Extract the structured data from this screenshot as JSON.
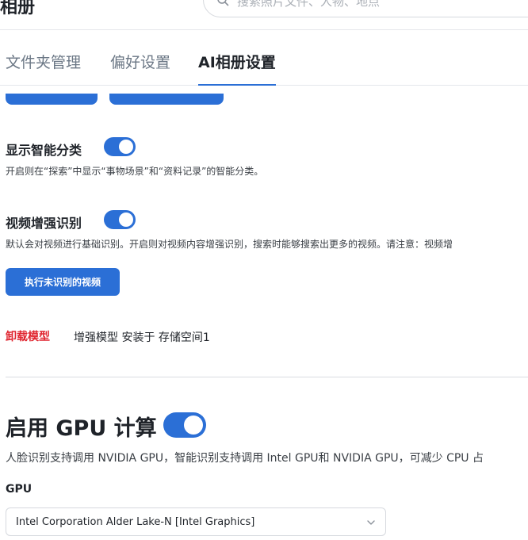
{
  "header": {
    "app_title": "相册",
    "search_placeholder": "搜索照片文件、人物、地点"
  },
  "tabs": [
    {
      "label": "文件夹管理",
      "active": false
    },
    {
      "label": "偏好设置",
      "active": false
    },
    {
      "label": "AI相册设置",
      "active": true
    }
  ],
  "smart_category": {
    "title": "显示智能分类",
    "enabled": true,
    "description": "开启则在“探索”中显示“事物场景”和“资料记录”的智能分类。"
  },
  "video_recognition": {
    "title": "视频增强识别",
    "enabled": true,
    "description": "默认会对视频进行基础识别。开启则对视频内容增强识别，搜索时能够搜索出更多的视频。请注意：视频增",
    "button_label": "执行未识别的视频"
  },
  "model": {
    "uninstall_label": "卸载模型",
    "status": "增强模型 安装于 存储空间1"
  },
  "gpu": {
    "title": "启用 GPU 计算",
    "enabled": true,
    "description": "人脸识别支持调用 NVIDIA GPU，智能识别支持调用 Intel GPU和 NVIDIA GPU，可减少 CPU 占",
    "select_label": "GPU",
    "selected_gpu": "Intel Corporation Alder Lake-N [Intel Graphics]"
  },
  "colors": {
    "accent": "#2b6fd6",
    "danger": "#e0252f"
  }
}
